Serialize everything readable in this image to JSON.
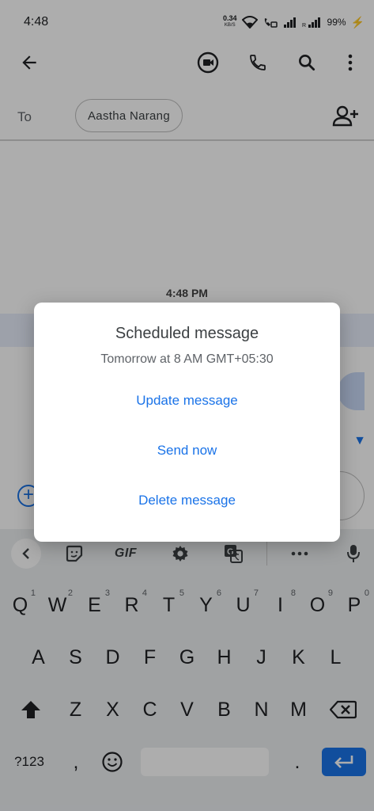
{
  "status_bar": {
    "time": "4:48",
    "net_speed_value": "0.34",
    "net_speed_unit": "KB/S",
    "battery": "99%",
    "icons": [
      "wifi-icon",
      "volte-icon",
      "signal-icon",
      "signal-roaming-icon",
      "battery-charging-icon"
    ]
  },
  "top_bar": {
    "icons": [
      "back-arrow-icon",
      "video-call-icon",
      "phone-icon",
      "search-icon",
      "more-vert-icon"
    ]
  },
  "recipient": {
    "to_label": "To",
    "chip_name": "Aastha Narang",
    "add_icon": "add-person-icon"
  },
  "conversation": {
    "timestamp": "4:48 PM"
  },
  "dialog": {
    "title": "Scheduled message",
    "subtitle": "Tomorrow at 8 AM GMT+05:30",
    "actions": [
      "Update message",
      "Send now",
      "Delete message"
    ]
  },
  "keyboard": {
    "toolbar": {
      "gif_label": "GIF",
      "icons": [
        "chevron-left-icon",
        "sticker-icon",
        "gif-icon",
        "settings-icon",
        "translate-icon",
        "more-horiz-icon",
        "mic-icon"
      ]
    },
    "row1": [
      "Q",
      "W",
      "E",
      "R",
      "T",
      "Y",
      "U",
      "I",
      "O",
      "P"
    ],
    "row1_hints": [
      "1",
      "2",
      "3",
      "4",
      "5",
      "6",
      "7",
      "8",
      "9",
      "0"
    ],
    "row2": [
      "A",
      "S",
      "D",
      "F",
      "G",
      "H",
      "J",
      "K",
      "L"
    ],
    "row3": [
      "Z",
      "X",
      "C",
      "V",
      "B",
      "N",
      "M"
    ],
    "symbols_label": "?123",
    "comma": ",",
    "period": "."
  },
  "colors": {
    "accent": "#1a73e8",
    "scrim": "rgba(0,0,0,0.32)",
    "keyboard_bg": "#eceff1"
  }
}
